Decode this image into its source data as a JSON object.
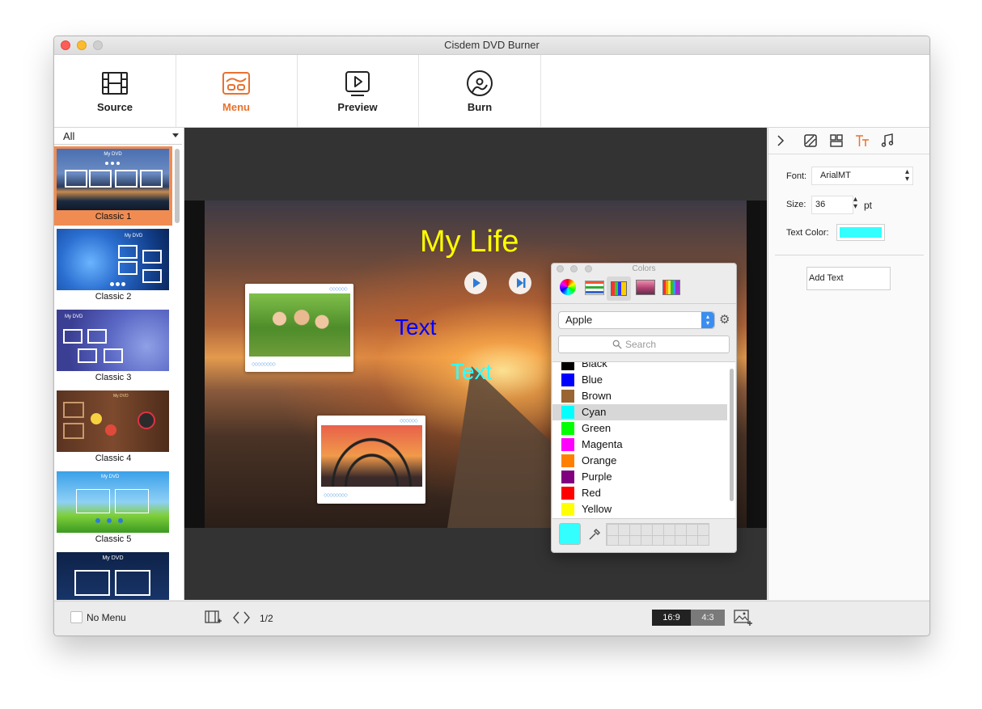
{
  "window": {
    "title": "Cisdem DVD Burner"
  },
  "toolbar": {
    "items": [
      {
        "label": "Source",
        "icon": "film-icon"
      },
      {
        "label": "Menu",
        "icon": "menu-template-icon",
        "active": true
      },
      {
        "label": "Preview",
        "icon": "play-icon"
      },
      {
        "label": "Burn",
        "icon": "disc-icon"
      }
    ],
    "accent_color": "#e8722e"
  },
  "templates": {
    "filter_value": "All",
    "items": [
      {
        "label": "Classic 1",
        "selected": true,
        "thumb_title": "My DVD"
      },
      {
        "label": "Classic 2",
        "thumb_title": "My DVD"
      },
      {
        "label": "Classic 3",
        "thumb_title": "My DVD"
      },
      {
        "label": "Classic 4",
        "thumb_title": "My DVD"
      },
      {
        "label": "Classic 5",
        "thumb_title": "My DVD"
      },
      {
        "label": "",
        "thumb_title": "My DVD"
      }
    ]
  },
  "canvas": {
    "title_text": "My Life",
    "title_color": "#ffff00",
    "text_blue": "Text",
    "text_blue_color": "#0000ff",
    "text_cyan": "Text",
    "text_cyan_color": "#33ffff"
  },
  "colors_panel": {
    "title": "Colors",
    "palette_select": "Apple",
    "search_placeholder": "Search",
    "items": [
      {
        "name": "Black",
        "color": "#000000"
      },
      {
        "name": "Blue",
        "color": "#0000ff"
      },
      {
        "name": "Brown",
        "color": "#996633"
      },
      {
        "name": "Cyan",
        "color": "#00ffff",
        "selected": true
      },
      {
        "name": "Green",
        "color": "#00ff00"
      },
      {
        "name": "Magenta",
        "color": "#ff00ff"
      },
      {
        "name": "Orange",
        "color": "#ff8000"
      },
      {
        "name": "Purple",
        "color": "#800080"
      },
      {
        "name": "Red",
        "color": "#ff0000"
      },
      {
        "name": "Yellow",
        "color": "#ffff00"
      }
    ],
    "current_color": "#33ffff"
  },
  "inspector": {
    "font_label": "Font:",
    "font_value": "ArialMT",
    "size_label": "Size:",
    "size_value": "36",
    "size_unit": "pt",
    "text_color_label": "Text Color:",
    "text_color_value": "#33ffff",
    "add_text_label": "Add Text"
  },
  "bottom": {
    "no_menu_label": "No Menu",
    "page_indicator": "1/2",
    "ratio_169": "16:9",
    "ratio_43": "4:3"
  }
}
